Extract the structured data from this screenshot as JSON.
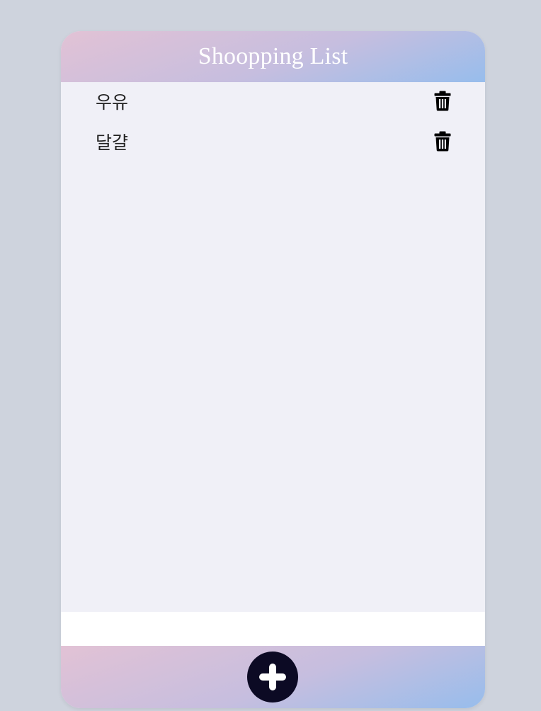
{
  "header": {
    "title": "Shoopping List"
  },
  "items": [
    {
      "label": "우유",
      "delete_icon": "trash-icon"
    },
    {
      "label": "달걀",
      "delete_icon": "trash-icon"
    }
  ],
  "input": {
    "value": "",
    "placeholder": ""
  },
  "footer": {
    "add_icon": "plus-icon"
  },
  "colors": {
    "background": "#ced3dd",
    "card": "#f0f0f7",
    "gradient_start": "#e2c2d5",
    "gradient_end": "#97bdec",
    "add_button": "#0c0a24"
  }
}
